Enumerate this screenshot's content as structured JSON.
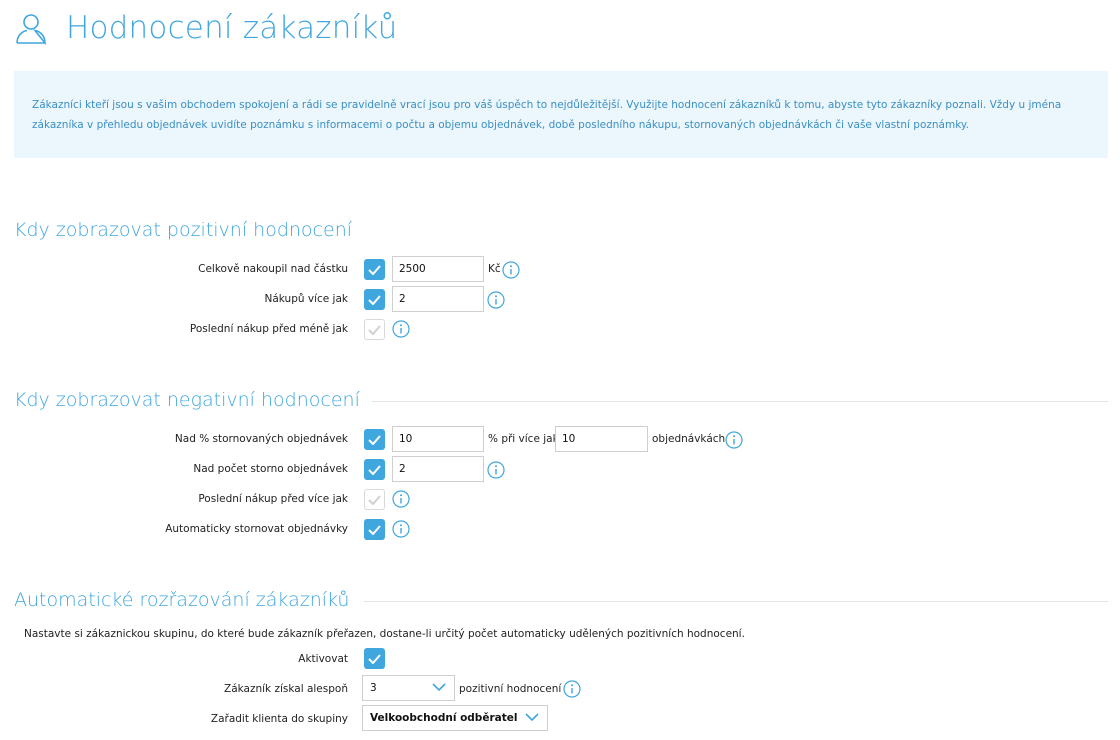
{
  "page": {
    "title": "Hodnocení zákazníků",
    "info_text": "Zákazníci kteří jsou s vašim obchodem spokojení a rádi se pravidelně vrací jsou pro váš úspěch to nejdůležitější. Využijte hodnocení zákazníků k tomu, abyste tyto zákazníky poznali. Vždy u jména zákazníka v přehledu objednávek uvidíte poznámku s informacemi o počtu a objemu objednávek, době posledního nákupu, stornovaných objednávkách či vaše vlastní poznámky."
  },
  "positive": {
    "title": "Kdy zobrazovat pozitivní hodnocení",
    "rows": [
      {
        "label": "Celkově nakoupil nad částku",
        "checked": true,
        "value": "2500",
        "suffix": "Kč"
      },
      {
        "label": "Nákupů více jak",
        "checked": true,
        "value": "2"
      },
      {
        "label": "Poslední nákup před méně jak",
        "checked": false
      }
    ]
  },
  "negative": {
    "title": "Kdy zobrazovat negativní hodnocení",
    "rows": [
      {
        "label": "Nad % stornovaných objednávek",
        "checked": true,
        "value": "10",
        "middle": "% při více jak",
        "value2": "10",
        "suffix": "objednávkách"
      },
      {
        "label": "Nad počet storno objednávek",
        "checked": true,
        "value": "2"
      },
      {
        "label": "Poslední nákup před více jak",
        "checked": false
      },
      {
        "label": "Automaticky stornovat objednávky",
        "checked": true
      }
    ]
  },
  "auto": {
    "title": "Automatické rozřazování zákazníků",
    "description": "Nastavte si zákaznickou skupinu, do které bude zákazník přeřazen, dostane-li určitý počet automaticky udělených pozitivních hodnocení.",
    "activate_label": "Aktivovat",
    "activate_checked": true,
    "min_label": "Zákazník získal alespoň",
    "min_value": "3",
    "min_suffix": "pozitivní hodnocení",
    "group_label": "Zařadit klienta do skupiny",
    "group_value": "Velkoobchodní odběratel"
  },
  "icons": {
    "header": "user-icon",
    "info": "info-circle-icon",
    "check": "checkmark-icon",
    "dropdown": "chevron-down-icon"
  },
  "colors": {
    "accent": "#3fa6de",
    "info_bg": "#ecf6fd",
    "info_text": "#3a8fc4"
  }
}
